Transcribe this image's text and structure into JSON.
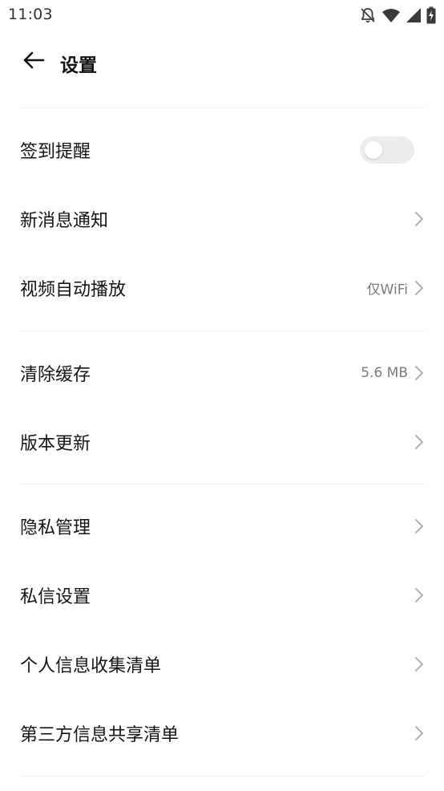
{
  "status_bar": {
    "time": "11:03",
    "icons": [
      "notifications-off-icon",
      "wifi-icon",
      "cellular-signal-icon",
      "battery-charging-icon"
    ]
  },
  "header": {
    "back_icon": "arrow-left-icon",
    "title": "设置"
  },
  "settings": {
    "sign_in_reminder": {
      "label": "签到提醒",
      "enabled": false
    },
    "new_message_notification": {
      "label": "新消息通知"
    },
    "video_autoplay": {
      "label": "视频自动播放",
      "value": "仅WiFi"
    },
    "clear_cache": {
      "label": "清除缓存",
      "value": "5.6 MB"
    },
    "version_update": {
      "label": "版本更新"
    },
    "privacy_management": {
      "label": "隐私管理"
    },
    "private_message_settings": {
      "label": "私信设置"
    },
    "personal_info_list": {
      "label": "个人信息收集清单"
    },
    "third_party_sharing_list": {
      "label": "第三方信息共享清单"
    }
  },
  "colors": {
    "text_primary": "#141414",
    "text_secondary": "#7a7a7a",
    "chevron": "#b0b0b0",
    "divider": "#eeeeee",
    "toggle_off_track": "#ececec"
  }
}
